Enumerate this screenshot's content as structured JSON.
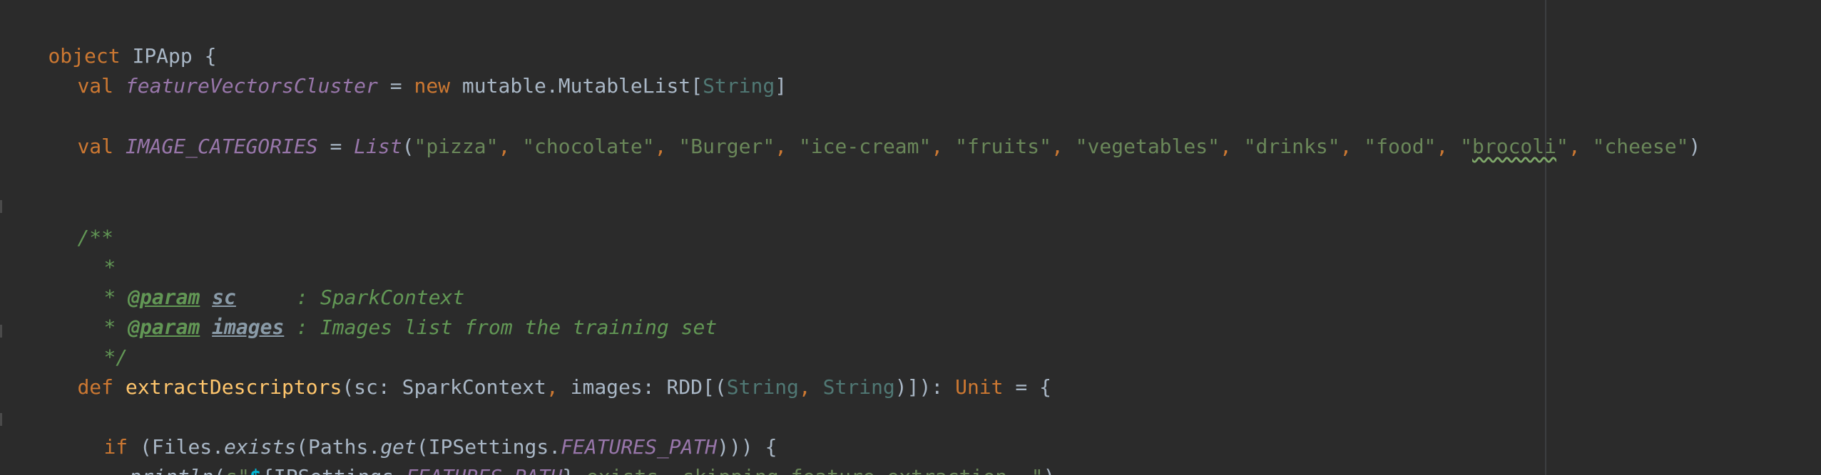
{
  "code": {
    "line1": {
      "kw_object": "object",
      "name": " IPApp {"
    },
    "line2": {
      "kw_val": "val",
      "field": "featureVectorsCluster",
      "eq": " = ",
      "kw_new": "new",
      "mid": " mutable.MutableList[",
      "type": "String",
      "end": "]"
    },
    "line3": {
      "kw_val": "val",
      "field": "IMAGE_CATEGORIES",
      "eq": " = ",
      "list_fn": "List",
      "open": "(",
      "items": [
        "\"pizza\"",
        "\"chocolate\"",
        "\"Burger\"",
        "\"ice-cream\"",
        "\"fruits\"",
        "\"vegetables\"",
        "\"drinks\"",
        "\"food\""
      ],
      "brocoli_pre": "\"",
      "brocoli_word": "brocoli",
      "brocoli_post": "\"",
      "cheese": "\"cheese\"",
      "comma": ", ",
      "close": ")"
    },
    "doc": {
      "open": "/**",
      "star": "*",
      "star_sp": "* ",
      "param_tag": "@param",
      "sc": "sc",
      "sc_desc": "     : SparkContext",
      "images": "images",
      "images_desc": " : Images list from the training set",
      "close": "*/"
    },
    "def_line": {
      "kw_def": "def",
      "fn_name": "extractDescriptors",
      "p1": "(sc: SparkContext",
      "comma": ", ",
      "p2": "images: RDD[(",
      "t1": "String",
      "t2": "String",
      "p3": ")]): ",
      "unit": "Unit",
      "end": " = {"
    },
    "if_line": {
      "kw_if": "if",
      "a": " (Files.",
      "exists": "exists",
      "b": "(Paths.",
      "get": "get",
      "c": "(IPSettings.",
      "features_path": "FEATURES_PATH",
      "d": "))) {"
    },
    "println_line": {
      "println": "println",
      "open": "(",
      "s_prefix": "s\"",
      "dollar": "$",
      "interp_open": "{IPSettings.",
      "features_path": "FEATURES_PATH",
      "interp_close": "}",
      "rest": " exists, skipping feature extraction..\"",
      "close": ")"
    }
  }
}
